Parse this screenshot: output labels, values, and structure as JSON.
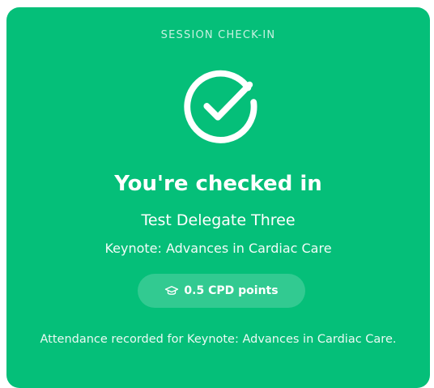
{
  "card": {
    "eyebrow": "SESSION CHECK-IN",
    "icon": "check-circle-icon",
    "title": "You're checked in",
    "delegate_name": "Test Delegate Three",
    "session_name": "Keynote: Advances in Cardiac Care",
    "cpd": {
      "icon": "graduation-cap-icon",
      "label": "0.5 CPD points"
    },
    "footer_message": "Attendance recorded for Keynote: Advances in Cardiac Care."
  },
  "colors": {
    "card_background": "#05bf79",
    "text": "#ffffff"
  }
}
